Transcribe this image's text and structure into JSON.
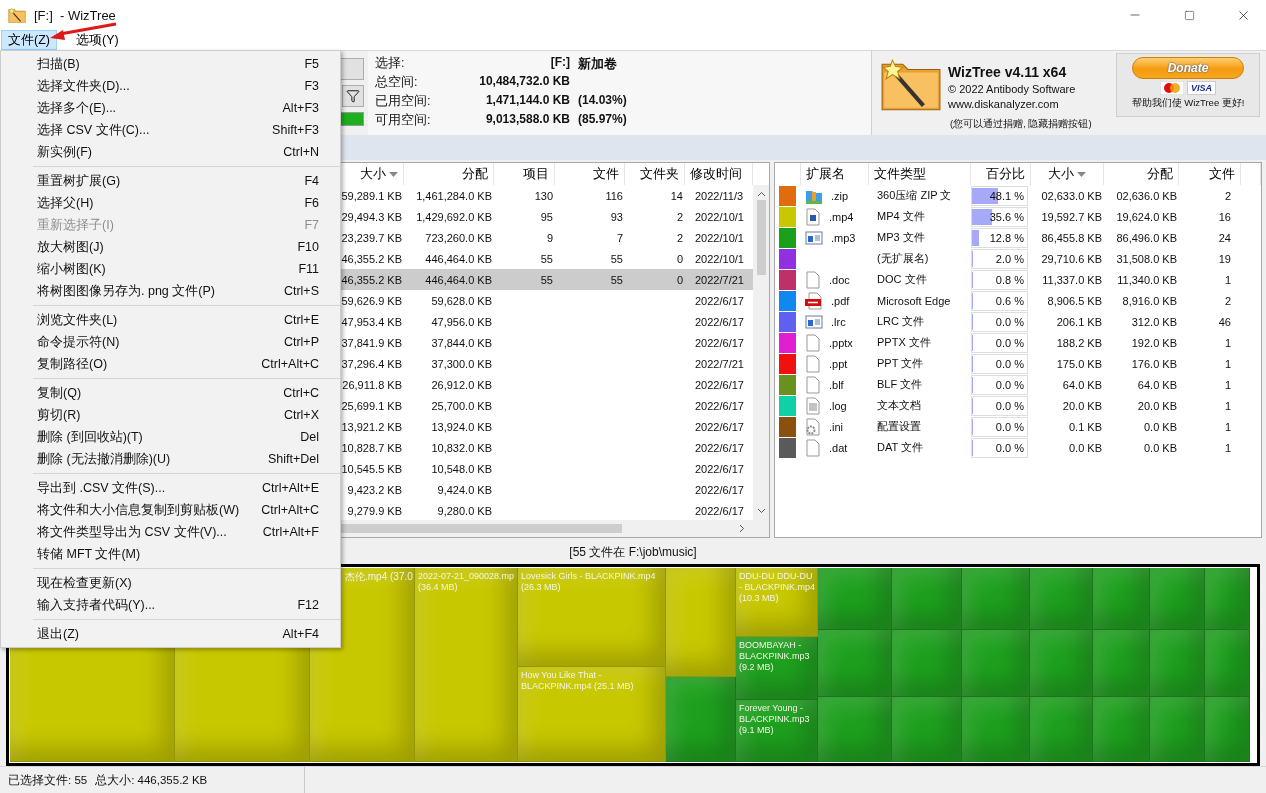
{
  "window": {
    "title": "[F:]  - WizTree"
  },
  "menubar": [
    {
      "label": "文件(Z)",
      "selected": true
    },
    {
      "label": "选项(Y)",
      "selected": false
    }
  ],
  "file_menu": {
    "groups": [
      [
        {
          "label": "扫描(B)",
          "shortcut": "F5",
          "disabled": false
        },
        {
          "label": "选择文件夹(D)...",
          "shortcut": "F3",
          "disabled": false
        },
        {
          "label": "选择多个(E)...",
          "shortcut": "Alt+F3",
          "disabled": false
        },
        {
          "label": "选择 CSV 文件(C)...",
          "shortcut": "Shift+F3",
          "disabled": false
        },
        {
          "label": "新实例(F)",
          "shortcut": "Ctrl+N",
          "disabled": false
        }
      ],
      [
        {
          "label": "重置树扩展(G)",
          "shortcut": "F4",
          "disabled": false
        },
        {
          "label": "选择父(H)",
          "shortcut": "F6",
          "disabled": false
        },
        {
          "label": "重新选择子(I)",
          "shortcut": "F7",
          "disabled": true
        },
        {
          "label": "放大树图(J)",
          "shortcut": "F10",
          "disabled": false
        },
        {
          "label": "缩小树图(K)",
          "shortcut": "F11",
          "disabled": false
        },
        {
          "label": "将树图图像另存为. png 文件(P)",
          "shortcut": "Ctrl+S",
          "disabled": false
        }
      ],
      [
        {
          "label": "浏览文件夹(L)",
          "shortcut": "Ctrl+E",
          "disabled": false
        },
        {
          "label": "命令提示符(N)",
          "shortcut": "Ctrl+P",
          "disabled": false
        },
        {
          "label": "复制路径(O)",
          "shortcut": "Ctrl+Alt+C",
          "disabled": false
        }
      ],
      [
        {
          "label": "复制(Q)",
          "shortcut": "Ctrl+C",
          "disabled": false
        },
        {
          "label": "剪切(R)",
          "shortcut": "Ctrl+X",
          "disabled": false
        },
        {
          "label": "删除 (到回收站)(T)",
          "shortcut": "Del",
          "disabled": false
        },
        {
          "label": "删除 (无法撤消删除)(U)",
          "shortcut": "Shift+Del",
          "disabled": false
        }
      ],
      [
        {
          "label": "导出到 .CSV 文件(S)...",
          "shortcut": "Ctrl+Alt+E",
          "disabled": false
        },
        {
          "label": "将文件和大小信息复制到剪贴板(W)",
          "shortcut": "Ctrl+Alt+C",
          "disabled": false
        },
        {
          "label": "将文件类型导出为 CSV 文件(V)...",
          "shortcut": "Ctrl+Alt+F",
          "disabled": false
        },
        {
          "label": "转储 MFT 文件(M)",
          "disabled": false
        }
      ],
      [
        {
          "label": "现在检查更新(X)",
          "disabled": false
        },
        {
          "label": "输入支持者代码(Y)...",
          "shortcut": "F12",
          "disabled": false
        }
      ],
      [
        {
          "label": "退出(Z)",
          "shortcut": "Alt+F4",
          "disabled": false
        }
      ]
    ]
  },
  "drive_info": {
    "select_label": "选择:",
    "drive": "[F:]",
    "volume": "新加卷",
    "rows": [
      {
        "label": "总空间:",
        "value": "10,484,732.0 KB"
      },
      {
        "label": "已用空间:",
        "value": "1,471,144.0 KB",
        "percent": "(14.03%)"
      },
      {
        "label": "可用空间:",
        "value": "9,013,588.0 KB",
        "percent": "(85.97%)"
      }
    ]
  },
  "about": {
    "title": "WizTree v4.11 x64",
    "copyright": "© 2022 Antibody Software",
    "website": "www.diskanalyzer.com",
    "note": "(您可以通过捐赠, 隐藏捐赠按钮)"
  },
  "donate": {
    "button": "Donate",
    "card": "VISA",
    "caption": "帮助我们使 WizTree 更好!"
  },
  "folder_table": {
    "columns": [
      {
        "label": "大小",
        "sorted": true
      },
      {
        "label": "分配",
        "sorted": false
      },
      {
        "label": "项目",
        "sorted": false
      },
      {
        "label": "文件",
        "sorted": false
      },
      {
        "label": "文件夹",
        "sorted": false
      },
      {
        "label": "修改时间",
        "sorted": false
      }
    ],
    "rows": [
      {
        "size": "59,289.1 KB",
        "allocated": "1,461,284.0 KB",
        "items": "130",
        "files": "116",
        "folders": "14",
        "modified": "2022/11/3",
        "selected": false
      },
      {
        "size": "29,494.3 KB",
        "allocated": "1,429,692.0 KB",
        "items": "95",
        "files": "93",
        "folders": "2",
        "modified": "2022/10/1",
        "selected": false
      },
      {
        "size": "23,239.7 KB",
        "allocated": "723,260.0 KB",
        "items": "9",
        "files": "7",
        "folders": "2",
        "modified": "2022/10/1",
        "selected": false
      },
      {
        "size": "46,355.2 KB",
        "allocated": "446,464.0 KB",
        "items": "55",
        "files": "55",
        "folders": "0",
        "modified": "2022/10/1",
        "selected": false
      },
      {
        "size": "46,355.2 KB",
        "allocated": "446,464.0 KB",
        "items": "55",
        "files": "55",
        "folders": "0",
        "modified": "2022/7/21",
        "selected": true
      },
      {
        "size": "59,626.9 KB",
        "allocated": "59,628.0 KB",
        "modified": "2022/6/17",
        "selected": false
      },
      {
        "size": "47,953.4 KB",
        "allocated": "47,956.0 KB",
        "modified": "2022/6/17",
        "selected": false
      },
      {
        "size": "37,841.9 KB",
        "allocated": "37,844.0 KB",
        "modified": "2022/6/17",
        "selected": false
      },
      {
        "size": "37,296.4 KB",
        "allocated": "37,300.0 KB",
        "modified": "2022/7/21",
        "selected": false
      },
      {
        "size": "26,911.8 KB",
        "allocated": "26,912.0 KB",
        "modified": "2022/6/17",
        "selected": false
      },
      {
        "size": "25,699.1 KB",
        "allocated": "25,700.0 KB",
        "modified": "2022/6/17",
        "selected": false
      },
      {
        "size": "13,921.2 KB",
        "allocated": "13,924.0 KB",
        "modified": "2022/6/17",
        "selected": false
      },
      {
        "size": "10,828.7 KB",
        "allocated": "10,832.0 KB",
        "modified": "2022/6/17",
        "selected": false
      },
      {
        "size": "10,545.5 KB",
        "allocated": "10,548.0 KB",
        "modified": "2022/6/17",
        "selected": false
      },
      {
        "size": "9,423.2 KB",
        "allocated": "9,424.0 KB",
        "modified": "2022/6/17",
        "selected": false
      },
      {
        "size": "9,279.9 KB",
        "allocated": "9,280.0 KB",
        "modified": "2022/6/17",
        "selected": false
      }
    ]
  },
  "type_table": {
    "columns": [
      {
        "label": "扩展名",
        "sorted": false
      },
      {
        "label": "文件类型",
        "sorted": false
      },
      {
        "label": "百分比",
        "sorted": false
      },
      {
        "label": "大小",
        "sorted": true
      },
      {
        "label": "分配",
        "sorted": false
      },
      {
        "label": "文件",
        "sorted": false
      }
    ],
    "rows": [
      {
        "color": "#e06c10",
        "kind": "archive",
        "ext": ".zip",
        "type": "360压缩 ZIP 文",
        "percent": "48.1 %",
        "level": 0.481,
        "size": "02,633.0 KB",
        "allocated": "02,636.0 KB",
        "files": "2"
      },
      {
        "color": "#c8c800",
        "kind": "image",
        "ext": ".mp4",
        "type": "MP4 文件",
        "percent": "35.6 %",
        "level": 0.356,
        "size": "19,592.7 KB",
        "allocated": "19,624.0 KB",
        "files": "16"
      },
      {
        "color": "#1aa01a",
        "kind": "media",
        "ext": ".mp3",
        "type": "MP3 文件",
        "percent": "12.8 %",
        "level": 0.128,
        "size": "86,455.8 KB",
        "allocated": "86,496.0 KB",
        "files": "24"
      },
      {
        "color": "#9030e0",
        "kind": "none",
        "type": "(无扩展名)",
        "percent": "2.0 %",
        "level": 0.02,
        "size": "29,710.6 KB",
        "allocated": "31,508.0 KB",
        "files": "19"
      },
      {
        "color": "#c03068",
        "kind": "blank",
        "ext": ".doc",
        "type": "DOC 文件",
        "percent": "0.8 %",
        "level": 0.008,
        "size": "11,337.0 KB",
        "allocated": "11,340.0 KB",
        "files": "1"
      },
      {
        "color": "#1088f0",
        "kind": "pdf",
        "ext": ".pdf",
        "type": "Microsoft Edge",
        "percent": "0.6 %",
        "level": 0.006,
        "size": "8,906.5 KB",
        "allocated": "8,916.0 KB",
        "files": "2"
      },
      {
        "color": "#6060f0",
        "kind": "media",
        "ext": ".lrc",
        "type": "LRC 文件",
        "percent": "0.0 %",
        "level": 0,
        "size": "206.1 KB",
        "allocated": "312.0 KB",
        "files": "46"
      },
      {
        "color": "#e020d0",
        "kind": "blank",
        "ext": ".pptx",
        "type": "PPTX 文件",
        "percent": "0.0 %",
        "level": 0,
        "size": "188.2 KB",
        "allocated": "192.0 KB",
        "files": "1"
      },
      {
        "color": "#f01010",
        "kind": "blank",
        "ext": ".ppt",
        "type": "PPT 文件",
        "percent": "0.0 %",
        "level": 0,
        "size": "175.0 KB",
        "allocated": "176.0 KB",
        "files": "1"
      },
      {
        "color": "#6a9020",
        "kind": "blank",
        "ext": ".blf",
        "type": "BLF 文件",
        "percent": "0.0 %",
        "level": 0,
        "size": "64.0 KB",
        "allocated": "64.0 KB",
        "files": "1"
      },
      {
        "color": "#10d0a8",
        "kind": "text",
        "ext": ".log",
        "type": "文本文档",
        "percent": "0.0 %",
        "level": 0,
        "size": "20.0 KB",
        "allocated": "20.0 KB",
        "files": "1"
      },
      {
        "color": "#8a5010",
        "kind": "settings",
        "ext": ".ini",
        "type": "配置设置",
        "percent": "0.0 %",
        "level": 0,
        "size": "0.1 KB",
        "allocated": "0.0 KB",
        "files": "1"
      },
      {
        "color": "#5a5a5a",
        "kind": "blank",
        "ext": ".dat",
        "type": "DAT 文件",
        "percent": "0.0 %",
        "level": 0,
        "size": "0.0 KB",
        "allocated": "0.0 KB",
        "files": "1"
      }
    ]
  },
  "path_label": "[55 文件在 F:\\job\\music]",
  "treemap": {
    "tiles": [
      {
        "color": "#c8c800"
      },
      {
        "color": "#c8c800"
      },
      {
        "color": "#c8c800",
        "lines": [
          "杰伦.mp4 (37.0"
        ]
      },
      {
        "color": "#c8c800",
        "lines": [
          "2022-07-21_090028.mp",
          "(36.4 MB)"
        ]
      },
      {
        "color": "#c8c800",
        "lines": [
          "Lovesick Girls - BLACKPINK.mp4",
          "(26.3 MB)"
        ]
      },
      {
        "color": "#c8c800",
        "lines": [
          "How You Like That -",
          "BLACKPINK.mp4 (25.1 MB)"
        ]
      },
      {
        "color": "#c8c800"
      },
      {
        "color": "#1ea01e"
      },
      {
        "color": "#c8c800",
        "lines": [
          "DDU-DU DDU-DU",
          "- BLACKPINK.mp4",
          "(10.3 MB)"
        ]
      },
      {
        "color": "#1ea01e",
        "lines": [
          "BOOMBAYAH -",
          "BLACKPINK.mp3",
          "(9.2 MB)"
        ]
      },
      {
        "color": "#1ea01e",
        "lines": [
          "Forever Young -",
          "BLACKPINK.mp3",
          "(9.1 MB)"
        ]
      },
      {
        "color": "#1ea01e"
      },
      {
        "color": "#1ea01e"
      },
      {
        "color": "#1ea01e"
      },
      {
        "color": "#1ea01e"
      },
      {
        "color": "#1ea01e"
      },
      {
        "color": "#1ea01e"
      },
      {
        "color": "#1ea01e"
      },
      {
        "color": "#1ea01e"
      },
      {
        "color": "#1ea01e"
      },
      {
        "color": "#1ea01e"
      },
      {
        "color": "#1ea01e"
      },
      {
        "color": "#1ea01e"
      },
      {
        "color": "#1ea01e"
      },
      {
        "color": "#1ea01e"
      },
      {
        "color": "#1ea01e"
      },
      {
        "color": "#1ea01e"
      },
      {
        "color": "#1ea01e"
      },
      {
        "color": "#1ea01e"
      },
      {
        "color": "#1ea01e"
      },
      {
        "color": "#1ea01e"
      },
      {
        "color": "#1ea01e"
      }
    ]
  },
  "status_bar": {
    "files": "已选择文件: 55",
    "size": "总大小: 446,355.2 KB"
  }
}
